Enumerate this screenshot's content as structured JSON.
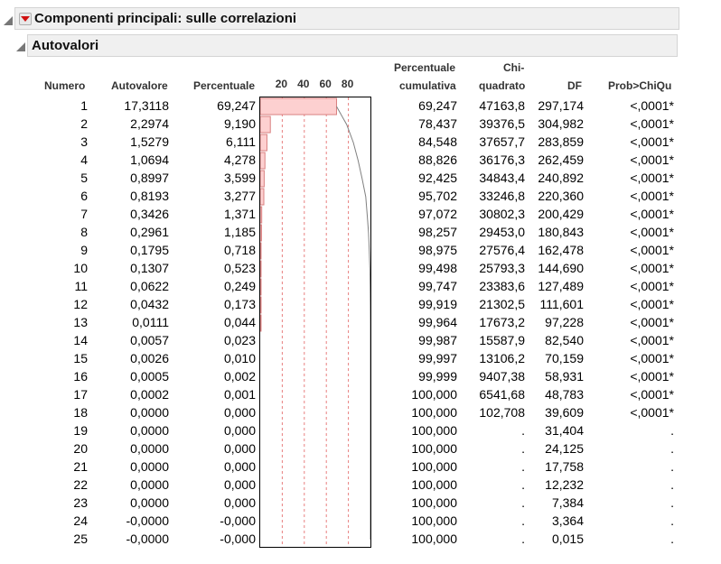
{
  "outline": {
    "main_title": "Componenti principali: sulle correlazioni",
    "sub_title": "Autovalori"
  },
  "columns": {
    "numero": "Numero",
    "autovalore": "Autovalore",
    "percentuale": "Percentuale",
    "cumulativa_1": "Percentuale",
    "cumulativa_2": "cumulativa",
    "chi_1": "Chi-",
    "chi_2": "quadrato",
    "df": "DF",
    "prob": "Prob>ChiQu"
  },
  "colors": {
    "bar_fill": "#fdd0d0",
    "bar_stroke": "#d98080",
    "ref_line": "#e88080",
    "curve": "#808080",
    "header_bg": "#f0f0f0"
  },
  "chart_data": {
    "type": "bar",
    "orientation": "horizontal",
    "ticks": [
      "20",
      "40",
      "60",
      "80"
    ],
    "xlim": [
      0,
      100
    ],
    "grid": true,
    "categories": [
      "1",
      "2",
      "3",
      "4",
      "5",
      "6",
      "7",
      "8",
      "9",
      "10",
      "11",
      "12",
      "13",
      "14",
      "15",
      "16",
      "17",
      "18",
      "19",
      "20",
      "21",
      "22",
      "23",
      "24",
      "25"
    ],
    "values": [
      69.247,
      9.19,
      6.111,
      4.278,
      3.599,
      3.277,
      1.371,
      1.185,
      0.718,
      0.523,
      0.249,
      0.173,
      0.044,
      0.023,
      0.01,
      0.002,
      0.001,
      0.0,
      0.0,
      0.0,
      0.0,
      0.0,
      0.0,
      0.0,
      0.0
    ],
    "cumulative": [
      69.247,
      78.437,
      84.548,
      88.826,
      92.425,
      95.702,
      97.072,
      98.257,
      98.975,
      99.498,
      99.747,
      99.919,
      99.964,
      99.987,
      99.997,
      99.999,
      100.0,
      100.0,
      100.0,
      100.0,
      100.0,
      100.0,
      100.0,
      100.0,
      100.0
    ]
  },
  "rows": [
    {
      "n": "1",
      "eig": "17,3118",
      "pct": "69,247",
      "cum": "69,247",
      "chi": "47163,8",
      "df": "297,174",
      "p": "<,0001*"
    },
    {
      "n": "2",
      "eig": "2,2974",
      "pct": "9,190",
      "cum": "78,437",
      "chi": "39376,5",
      "df": "304,982",
      "p": "<,0001*"
    },
    {
      "n": "3",
      "eig": "1,5279",
      "pct": "6,111",
      "cum": "84,548",
      "chi": "37657,7",
      "df": "283,859",
      "p": "<,0001*"
    },
    {
      "n": "4",
      "eig": "1,0694",
      "pct": "4,278",
      "cum": "88,826",
      "chi": "36176,3",
      "df": "262,459",
      "p": "<,0001*"
    },
    {
      "n": "5",
      "eig": "0,8997",
      "pct": "3,599",
      "cum": "92,425",
      "chi": "34843,4",
      "df": "240,892",
      "p": "<,0001*"
    },
    {
      "n": "6",
      "eig": "0,8193",
      "pct": "3,277",
      "cum": "95,702",
      "chi": "33246,8",
      "df": "220,360",
      "p": "<,0001*"
    },
    {
      "n": "7",
      "eig": "0,3426",
      "pct": "1,371",
      "cum": "97,072",
      "chi": "30802,3",
      "df": "200,429",
      "p": "<,0001*"
    },
    {
      "n": "8",
      "eig": "0,2961",
      "pct": "1,185",
      "cum": "98,257",
      "chi": "29453,0",
      "df": "180,843",
      "p": "<,0001*"
    },
    {
      "n": "9",
      "eig": "0,1795",
      "pct": "0,718",
      "cum": "98,975",
      "chi": "27576,4",
      "df": "162,478",
      "p": "<,0001*"
    },
    {
      "n": "10",
      "eig": "0,1307",
      "pct": "0,523",
      "cum": "99,498",
      "chi": "25793,3",
      "df": "144,690",
      "p": "<,0001*"
    },
    {
      "n": "11",
      "eig": "0,0622",
      "pct": "0,249",
      "cum": "99,747",
      "chi": "23383,6",
      "df": "127,489",
      "p": "<,0001*"
    },
    {
      "n": "12",
      "eig": "0,0432",
      "pct": "0,173",
      "cum": "99,919",
      "chi": "21302,5",
      "df": "111,601",
      "p": "<,0001*"
    },
    {
      "n": "13",
      "eig": "0,0111",
      "pct": "0,044",
      "cum": "99,964",
      "chi": "17673,2",
      "df": "97,228",
      "p": "<,0001*"
    },
    {
      "n": "14",
      "eig": "0,0057",
      "pct": "0,023",
      "cum": "99,987",
      "chi": "15587,9",
      "df": "82,540",
      "p": "<,0001*"
    },
    {
      "n": "15",
      "eig": "0,0026",
      "pct": "0,010",
      "cum": "99,997",
      "chi": "13106,2",
      "df": "70,159",
      "p": "<,0001*"
    },
    {
      "n": "16",
      "eig": "0,0005",
      "pct": "0,002",
      "cum": "99,999",
      "chi": "9407,38",
      "df": "58,931",
      "p": "<,0001*"
    },
    {
      "n": "17",
      "eig": "0,0002",
      "pct": "0,001",
      "cum": "100,000",
      "chi": "6541,68",
      "df": "48,783",
      "p": "<,0001*"
    },
    {
      "n": "18",
      "eig": "0,0000",
      "pct": "0,000",
      "cum": "100,000",
      "chi": "102,708",
      "df": "39,609",
      "p": "<,0001*"
    },
    {
      "n": "19",
      "eig": "0,0000",
      "pct": "0,000",
      "cum": "100,000",
      "chi": ".",
      "df": "31,404",
      "p": "."
    },
    {
      "n": "20",
      "eig": "0,0000",
      "pct": "0,000",
      "cum": "100,000",
      "chi": ".",
      "df": "24,125",
      "p": "."
    },
    {
      "n": "21",
      "eig": "0,0000",
      "pct": "0,000",
      "cum": "100,000",
      "chi": ".",
      "df": "17,758",
      "p": "."
    },
    {
      "n": "22",
      "eig": "0,0000",
      "pct": "0,000",
      "cum": "100,000",
      "chi": ".",
      "df": "12,232",
      "p": "."
    },
    {
      "n": "23",
      "eig": "0,0000",
      "pct": "0,000",
      "cum": "100,000",
      "chi": ".",
      "df": "7,384",
      "p": "."
    },
    {
      "n": "24",
      "eig": "-0,0000",
      "pct": "-0,000",
      "cum": "100,000",
      "chi": ".",
      "df": "3,364",
      "p": "."
    },
    {
      "n": "25",
      "eig": "-0,0000",
      "pct": "-0,000",
      "cum": "100,000",
      "chi": ".",
      "df": "0,015",
      "p": "."
    }
  ]
}
